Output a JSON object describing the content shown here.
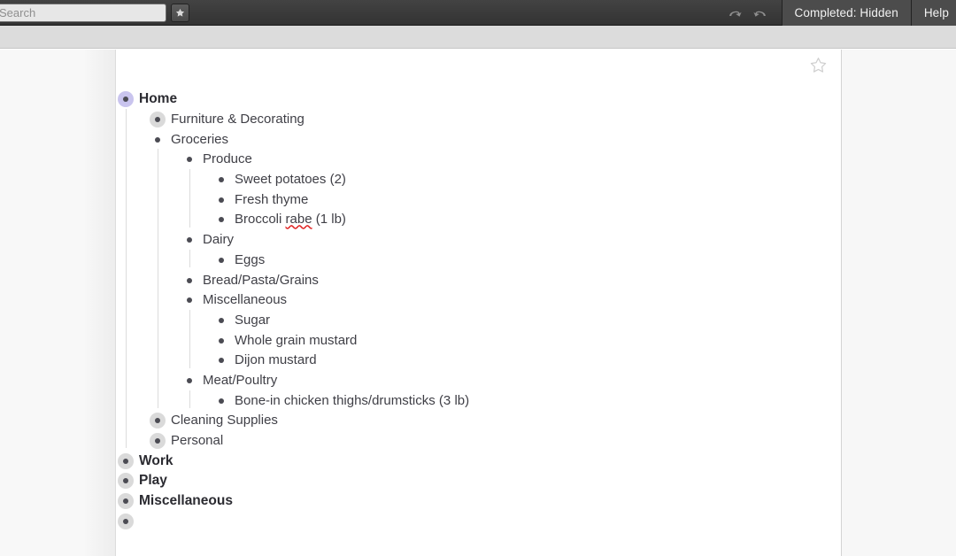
{
  "toolbar": {
    "search_value": "",
    "search_placeholder": "Search",
    "star_button_label": "★",
    "undo_icon": "undo-arrow-icon",
    "redo_icon": "redo-arrow-icon",
    "completed_label": "Completed: Hidden",
    "help_label": "Help"
  },
  "document": {
    "favorite_star_icon": "star-outline-icon"
  },
  "outline": {
    "nodes": [
      {
        "label": "Home",
        "bold": true,
        "halo": "purple",
        "expanded": true,
        "children": [
          {
            "label": "Furniture & Decorating",
            "halo": "gray",
            "expanded": false,
            "children": []
          },
          {
            "label": "Groceries",
            "halo": "none",
            "expanded": true,
            "children": [
              {
                "label": "Produce",
                "halo": "none",
                "expanded": true,
                "children": [
                  {
                    "label": "Sweet potatoes (2)",
                    "halo": "none",
                    "expanded": false,
                    "children": []
                  },
                  {
                    "label": "Fresh thyme",
                    "halo": "none",
                    "expanded": false,
                    "children": []
                  },
                  {
                    "label": "Broccoli rabe (1 lb)",
                    "halo": "none",
                    "expanded": false,
                    "children": [],
                    "misspelled": "rabe"
                  }
                ]
              },
              {
                "label": "Dairy",
                "halo": "none",
                "expanded": true,
                "children": [
                  {
                    "label": "Eggs",
                    "halo": "none",
                    "expanded": false,
                    "children": []
                  }
                ]
              },
              {
                "label": "Bread/Pasta/Grains",
                "halo": "none",
                "expanded": false,
                "children": []
              },
              {
                "label": "Miscellaneous",
                "halo": "none",
                "expanded": true,
                "children": [
                  {
                    "label": "Sugar",
                    "halo": "none",
                    "expanded": false,
                    "children": []
                  },
                  {
                    "label": "Whole grain mustard",
                    "halo": "none",
                    "expanded": false,
                    "children": []
                  },
                  {
                    "label": "Dijon mustard",
                    "halo": "none",
                    "expanded": false,
                    "children": []
                  }
                ]
              },
              {
                "label": "Meat/Poultry",
                "halo": "none",
                "expanded": true,
                "children": [
                  {
                    "label": "Bone-in chicken thighs/drumsticks (3 lb)",
                    "halo": "none",
                    "expanded": false,
                    "children": []
                  }
                ]
              }
            ]
          },
          {
            "label": "Cleaning Supplies",
            "halo": "gray",
            "expanded": false,
            "children": []
          },
          {
            "label": "Personal",
            "halo": "gray",
            "expanded": false,
            "children": []
          }
        ]
      },
      {
        "label": "Work",
        "bold": true,
        "halo": "gray",
        "expanded": false,
        "children": []
      },
      {
        "label": "Play",
        "bold": true,
        "halo": "gray",
        "expanded": false,
        "children": []
      },
      {
        "label": "Miscellaneous",
        "bold": true,
        "halo": "gray",
        "expanded": false,
        "children": []
      },
      {
        "label": "",
        "bold": true,
        "halo": "gray",
        "expanded": false,
        "children": []
      }
    ]
  },
  "colors": {
    "toolbar_bg": "#3a3a3a",
    "subbar_bg": "#dcdcdc",
    "panel_bg": "#ffffff",
    "text": "#3f3f46",
    "halo_gray": "#dadada",
    "halo_purple": "#c9c4ee",
    "spellcheck": "#e02020"
  }
}
